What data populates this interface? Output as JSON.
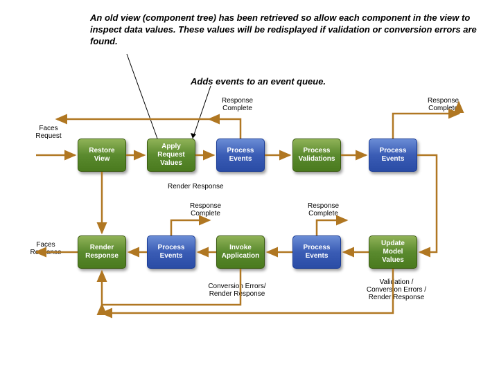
{
  "captions": {
    "top": "An old view (component tree) has been retrieved so allow each component in the view to inspect data values. These values will be redisplayed if validation or conversion errors are found.",
    "sub": "Adds events to an event queue."
  },
  "io_labels": {
    "request": "Faces\nRequest",
    "response": "Faces\nResponse"
  },
  "boxes": {
    "restore_view": "Restore\nView",
    "apply_request_values": "Apply\nRequest\nValues",
    "process_events_1": "Process\nEvents",
    "process_validations": "Process\nValidations",
    "process_events_2": "Process\nEvents",
    "render_response": "Render\nResponse",
    "process_events_4": "Process\nEvents",
    "invoke_application": "Invoke\nApplication",
    "process_events_3": "Process\nEvents",
    "update_model_values": "Update\nModel\nValues"
  },
  "flow_labels": {
    "response_complete_1": "Response\nComplete",
    "response_complete_2": "Response\nComplete",
    "render_response_mid": "Render Response",
    "response_complete_3": "Response\nComplete",
    "response_complete_4": "Response\nComplete",
    "conversion_errors": "Conversion Errors/\nRender Response",
    "validation_errors": "Validation /\nConversion Errors /\nRender Response"
  }
}
